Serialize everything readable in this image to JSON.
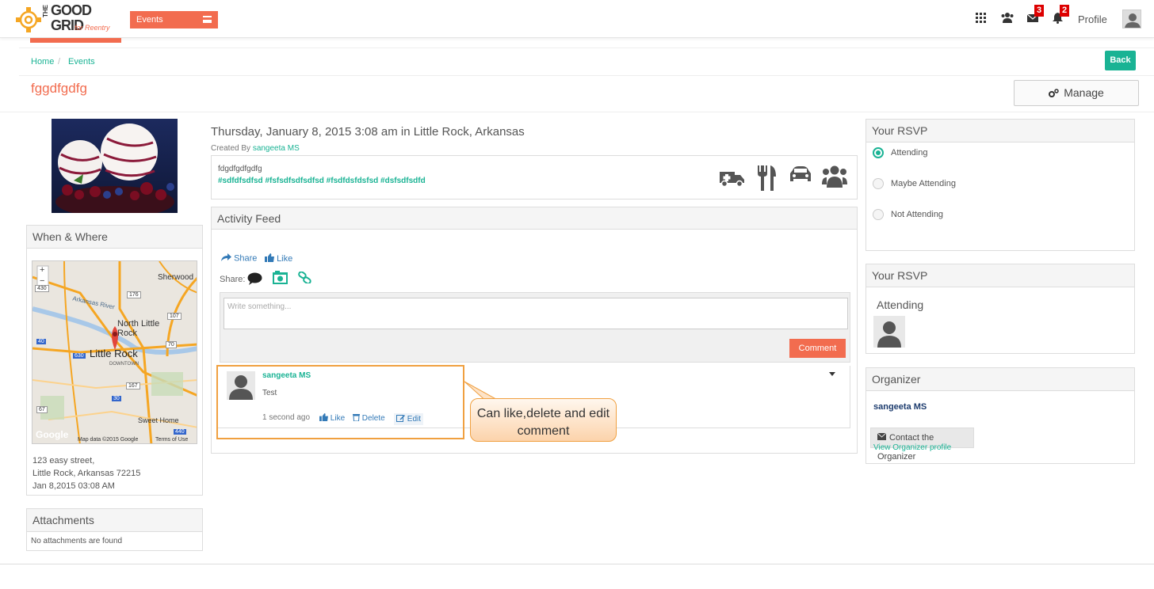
{
  "header": {
    "logo_lines": [
      "THE",
      "GOOD",
      "GRID",
      "for Reentry"
    ],
    "events_label": "Events",
    "messages_count": "3",
    "notifications_count": "2",
    "profile_label": "Profile"
  },
  "breadcrumb": {
    "home": "Home",
    "separator": "/",
    "current": "Events"
  },
  "back_label": "Back",
  "page_title": "fggdfgdfg",
  "manage_label": "Manage",
  "event": {
    "when_where": "Thursday, January 8, 2015 3:08 am in Little Rock, Arkansas",
    "created_by_prefix": "Created By",
    "created_by_name": "sangeeta MS",
    "description": "fdgdfgdfgdfg",
    "hashtags": "#sdfdfsdfsd #fsfsdfsdfsdfsd #fsdfdsfdsfsd #dsfsdfsdfd",
    "amenity_icons": [
      "medical-truck-icon",
      "dining-icon",
      "car-icon",
      "group-icon"
    ]
  },
  "when_where_panel": {
    "title": "When & Where",
    "map_labels": {
      "sherwood": "Sherwood",
      "north_little_rock": "North Little Rock",
      "little_rock": "Little Rock",
      "downtown": "DOWNTOWN",
      "sweet_home": "Sweet Home",
      "arkansas_river": "Arkansas River",
      "attribution": "Map data ©2015 Google",
      "terms": "Terms of Use",
      "google": "Google",
      "zoom_in": "+",
      "zoom_out": "−",
      "shields": [
        "430",
        "176",
        "107",
        "40",
        "70",
        "630",
        "167",
        "30",
        "67",
        "440"
      ]
    },
    "address_lines": [
      "123 easy street,",
      "Little Rock, Arkansas 72215",
      "Jan 8,2015 03:08 AM"
    ]
  },
  "attachments": {
    "title": "Attachments",
    "empty_text": "No attachments are found"
  },
  "activity_feed": {
    "title": "Activity Feed",
    "share_link": "Share",
    "like_link": "Like",
    "share_label": "Share:",
    "compose_placeholder": "Write something...",
    "comment_button": "Comment",
    "comment": {
      "author": "sangeeta MS",
      "text": "Test",
      "time": "1 second ago",
      "like": "Like",
      "delete": "Delete",
      "edit": "Edit"
    }
  },
  "callout_text": "Can like,delete and edit comment",
  "rsvp": {
    "title": "Your RSVP",
    "options": [
      "Attending",
      "Maybe Attending",
      "Not Attending"
    ],
    "selected": "Attending"
  },
  "rsvp_summary": {
    "title": "Your RSVP",
    "status": "Attending"
  },
  "organizer": {
    "title": "Organizer",
    "name": "sangeeta MS",
    "contact_button": "Contact the Organizer",
    "profile_link": "View Organizer profile"
  },
  "colors": {
    "brand_orange": "#f26c4f",
    "brand_teal": "#1ab394",
    "badge_red": "#dd0000",
    "link_blue": "#337ab7"
  }
}
